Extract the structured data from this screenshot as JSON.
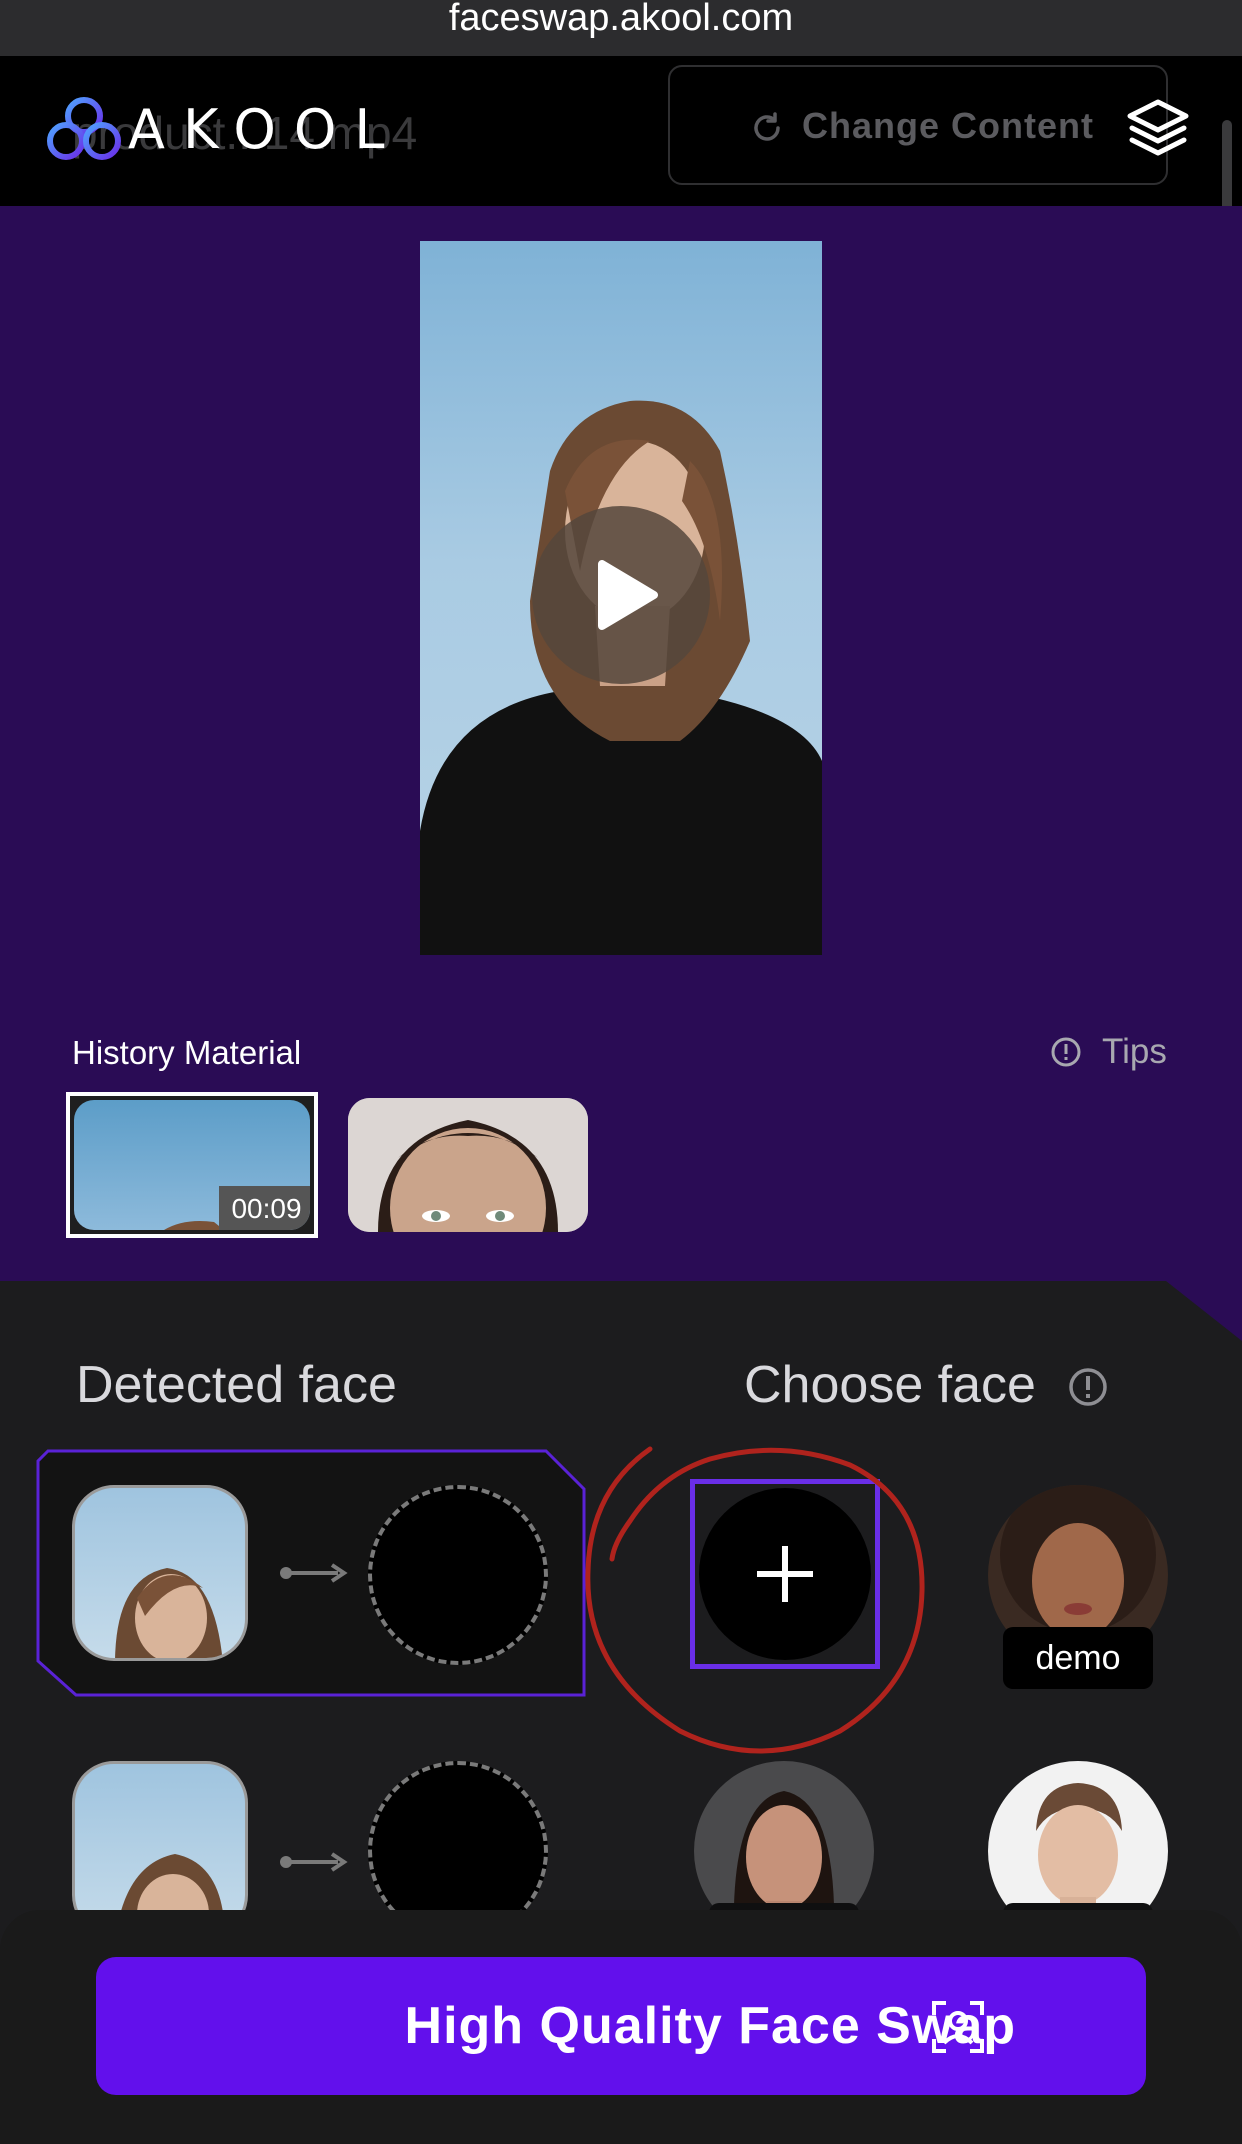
{
  "browser": {
    "url": "faceswap.akool.com"
  },
  "header": {
    "logo_text": "AKOOL",
    "ghost_filename": "product...14.mp4",
    "change_content_label": "Change Content",
    "layers_icon": "layers-icon"
  },
  "preview": {
    "play_icon": "play-icon"
  },
  "history": {
    "title": "History Material",
    "tips_label": "Tips",
    "items": [
      {
        "duration": "00:09",
        "selected": true
      },
      {
        "selected": false
      }
    ]
  },
  "faces": {
    "detected_title": "Detected face",
    "choose_title": "Choose face",
    "rows": [
      {
        "target": "empty"
      },
      {
        "target": "empty"
      }
    ],
    "demo_label": "demo"
  },
  "action": {
    "swap_label": "High Quality Face Swap"
  },
  "colors": {
    "accent": "#6210ec",
    "preview_bg": "#2a0c55",
    "annotation": "#b0231d"
  }
}
